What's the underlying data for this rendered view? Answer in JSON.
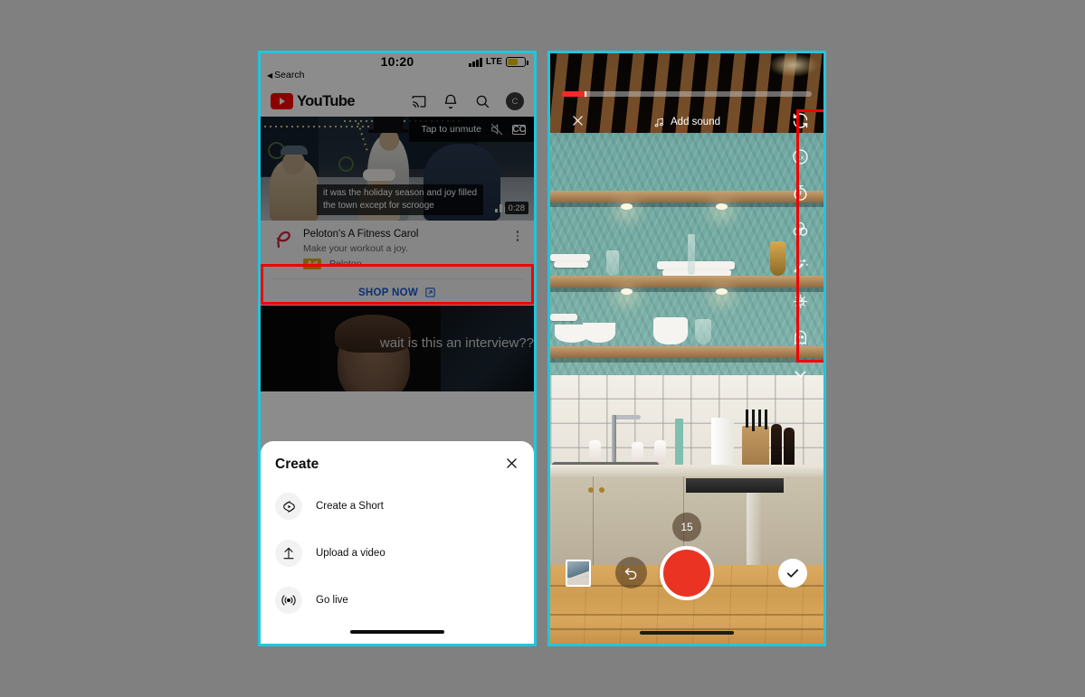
{
  "meta": {
    "highlight_color": "#f20000",
    "panel_border_color": "#22c5dd",
    "background_color": "#808080"
  },
  "left_phone": {
    "status_bar": {
      "time": "10:20",
      "back_label": "Search",
      "back_arrow": "◀",
      "carrier": "LTE",
      "signal_icon": "signal-bars-icon",
      "battery_icon": "battery-icon"
    },
    "app_header": {
      "logo_text": "YouTube",
      "logo_icon": "youtube-play-icon",
      "actions": [
        {
          "name": "cast-icon",
          "label": "Cast"
        },
        {
          "name": "bell-icon",
          "label": "Notifications"
        },
        {
          "name": "search-icon",
          "label": "Search"
        }
      ],
      "avatar_initial": "C"
    },
    "video_card_1": {
      "unmute_label": "Tap to unmute",
      "mute_icon": "muted-speaker-icon",
      "cc_label": "CC",
      "caption_line_1": "it was the holiday season and joy filled",
      "caption_line_2": "the town except for scrooge",
      "duration": "0:28",
      "stats_icon": "bar-chart-icon"
    },
    "ad": {
      "brand_logo_icon": "peloton-logo-icon",
      "title": "Peloton's A Fitness Carol",
      "subtitle": "Make your workout a joy.",
      "badge": "Ad",
      "advertiser": "Peloton",
      "cta_label": "SHOP NOW",
      "cta_icon": "external-link-icon",
      "menu_icon": "kebab-menu-icon"
    },
    "video_card_2": {
      "caption": "wait is this an interview??"
    },
    "create_sheet": {
      "title": "Create",
      "close_icon": "close-icon",
      "items": [
        {
          "label": "Create a Short",
          "icon": "shorts-icon",
          "highlighted": true
        },
        {
          "label": "Upload a video",
          "icon": "upload-arrow-icon",
          "highlighted": false
        },
        {
          "label": "Go live",
          "icon": "broadcast-icon",
          "highlighted": false
        }
      ],
      "home_indicator": "home-indicator"
    }
  },
  "right_phone": {
    "progress": {
      "recorded_percent": 9,
      "fill_color": "#f32b26",
      "track_color": "rgba(190,190,190,0.55)"
    },
    "top_bar": {
      "close_icon": "close-icon",
      "add_sound_label": "Add sound",
      "music_note_icon": "music-note-icon"
    },
    "tools": [
      {
        "name": "flip-camera-icon",
        "label": "Flip camera"
      },
      {
        "name": "speed-1x-icon",
        "label": "1x"
      },
      {
        "name": "timer-icon",
        "label": "Timer"
      },
      {
        "name": "filters-icon",
        "label": "Filters"
      },
      {
        "name": "effects-wand-icon",
        "label": "Effects"
      },
      {
        "name": "retouch-icon",
        "label": "Retouch"
      },
      {
        "name": "green-screen-ghost-icon",
        "label": "Green screen"
      },
      {
        "name": "chevron-down-icon",
        "label": "More"
      }
    ],
    "duration_badge": "15",
    "bottom_bar": {
      "gallery_icon": "gallery-thumbnail-icon",
      "undo_icon": "undo-arrow-icon",
      "record_icon": "record-button",
      "record_color": "#ea3323",
      "done_icon": "checkmark-icon"
    },
    "home_indicator": "home-indicator"
  }
}
